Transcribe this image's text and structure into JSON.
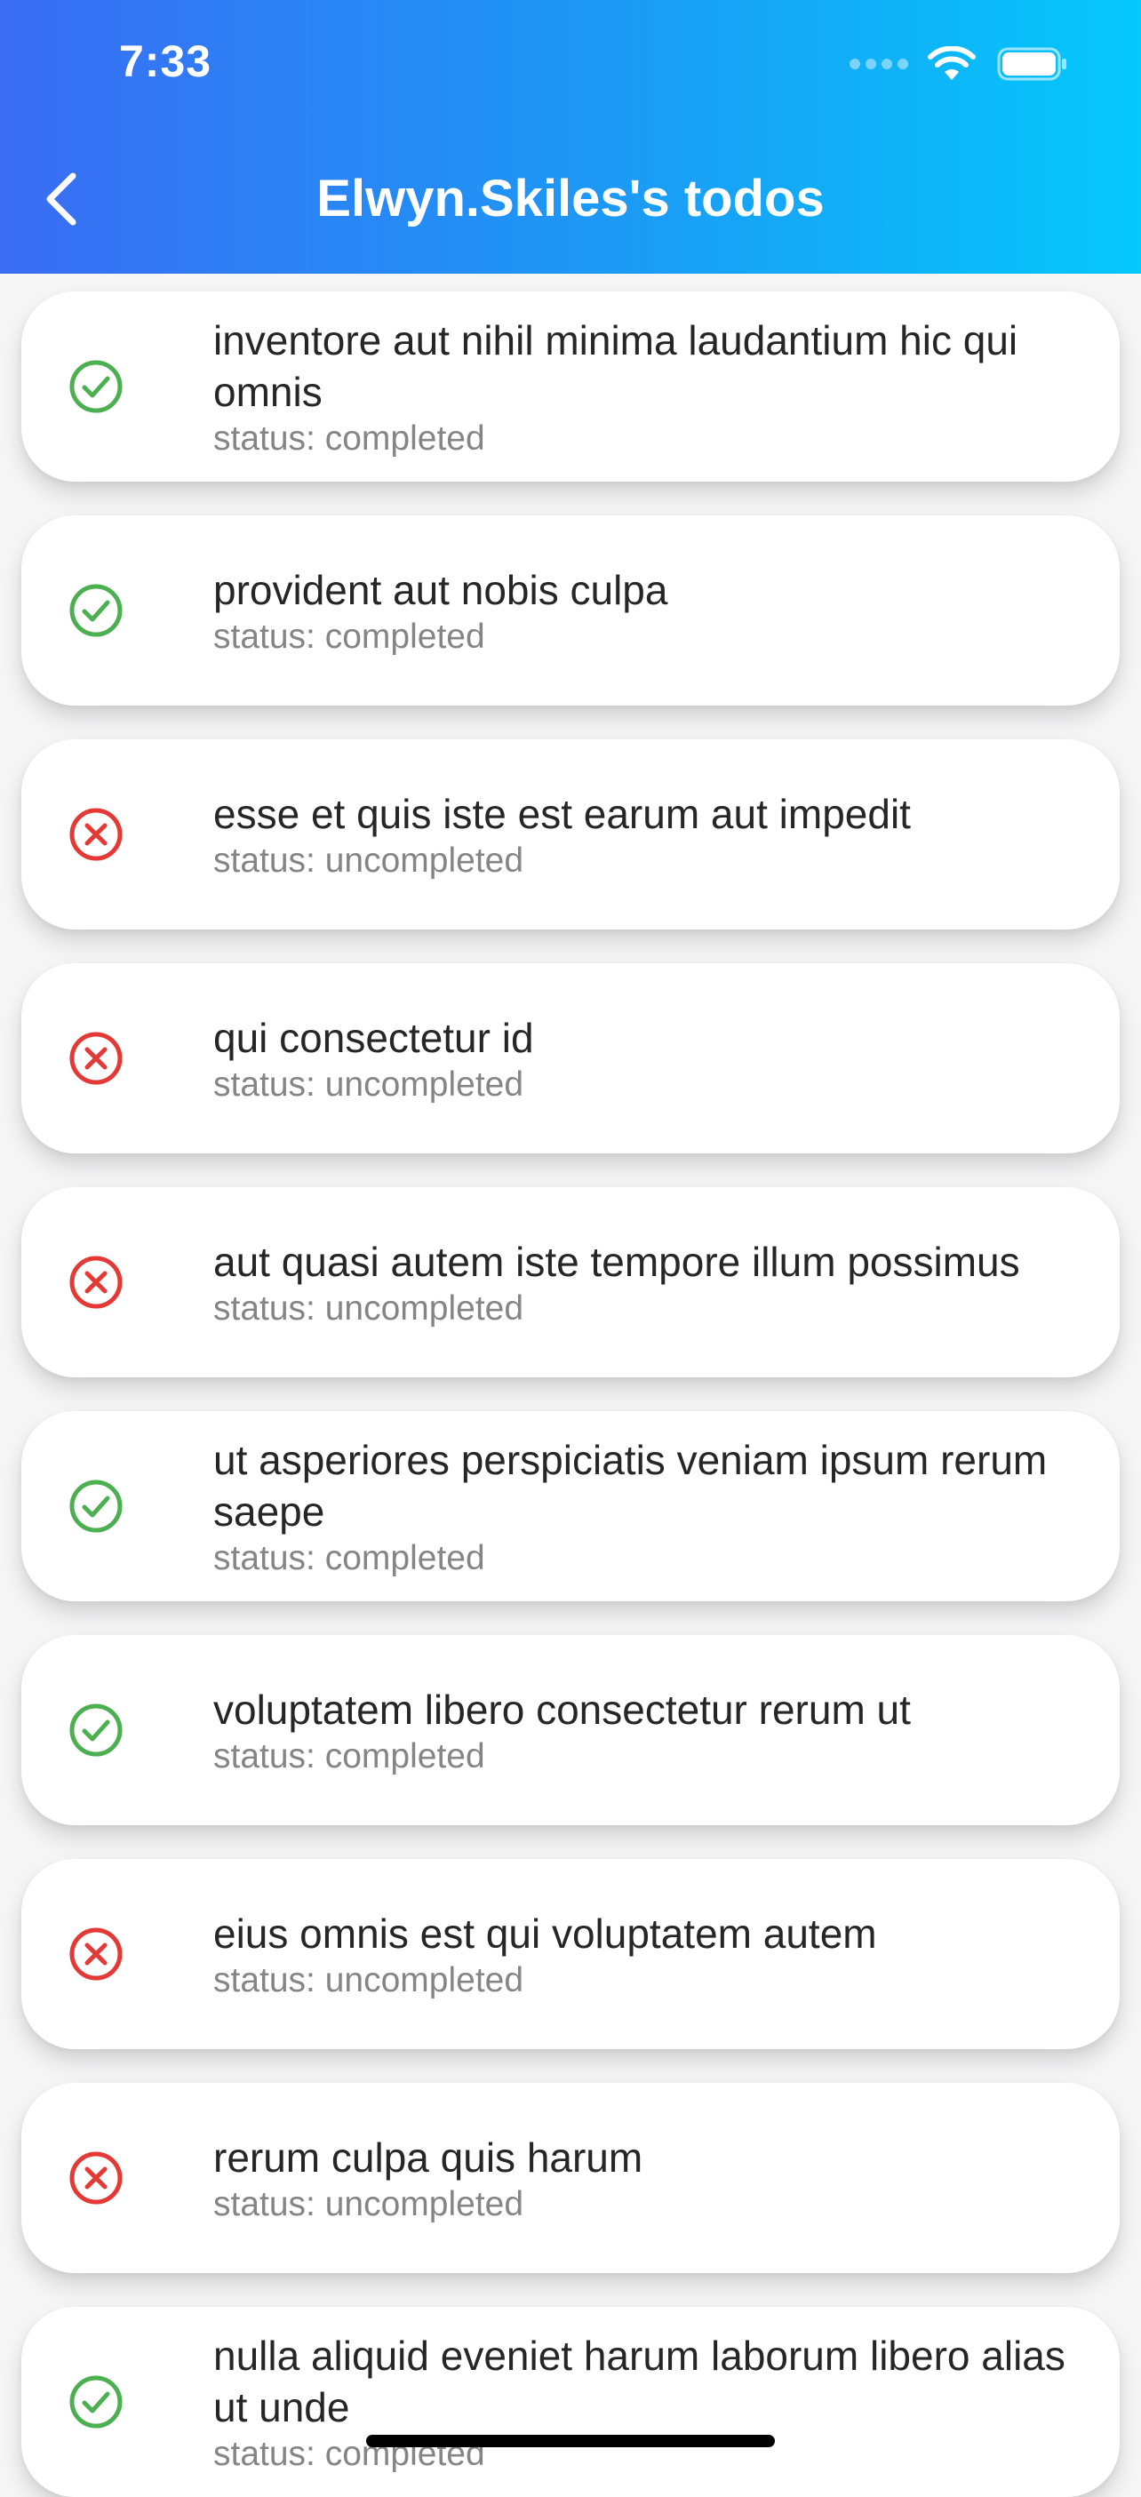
{
  "status_bar": {
    "time": "7:33"
  },
  "app_bar": {
    "title": "Elwyn.Skiles's todos",
    "back_icon": "chevron-left-icon"
  },
  "colors": {
    "gradient_start": "#3a6cf4",
    "gradient_end": "#05c8fb",
    "completed": "#4caf50",
    "uncompleted": "#e53935"
  },
  "todos": [
    {
      "title": "inventore aut nihil minima laudantium hic qui omnis",
      "status": "status: completed",
      "completed": true
    },
    {
      "title": "provident aut nobis culpa",
      "status": "status: completed",
      "completed": true
    },
    {
      "title": "esse et quis iste est earum aut impedit",
      "status": "status: uncompleted",
      "completed": false
    },
    {
      "title": "qui consectetur id",
      "status": "status: uncompleted",
      "completed": false
    },
    {
      "title": "aut quasi autem iste tempore illum possimus",
      "status": "status: uncompleted",
      "completed": false
    },
    {
      "title": "ut asperiores perspiciatis veniam ipsum rerum saepe",
      "status": "status: completed",
      "completed": true
    },
    {
      "title": "voluptatem libero consectetur rerum ut",
      "status": "status: completed",
      "completed": true
    },
    {
      "title": "eius omnis est qui voluptatem autem",
      "status": "status: uncompleted",
      "completed": false
    },
    {
      "title": "rerum culpa quis harum",
      "status": "status: uncompleted",
      "completed": false
    },
    {
      "title": "nulla aliquid eveniet harum laborum libero alias ut unde",
      "status": "status: completed",
      "completed": true
    }
  ]
}
